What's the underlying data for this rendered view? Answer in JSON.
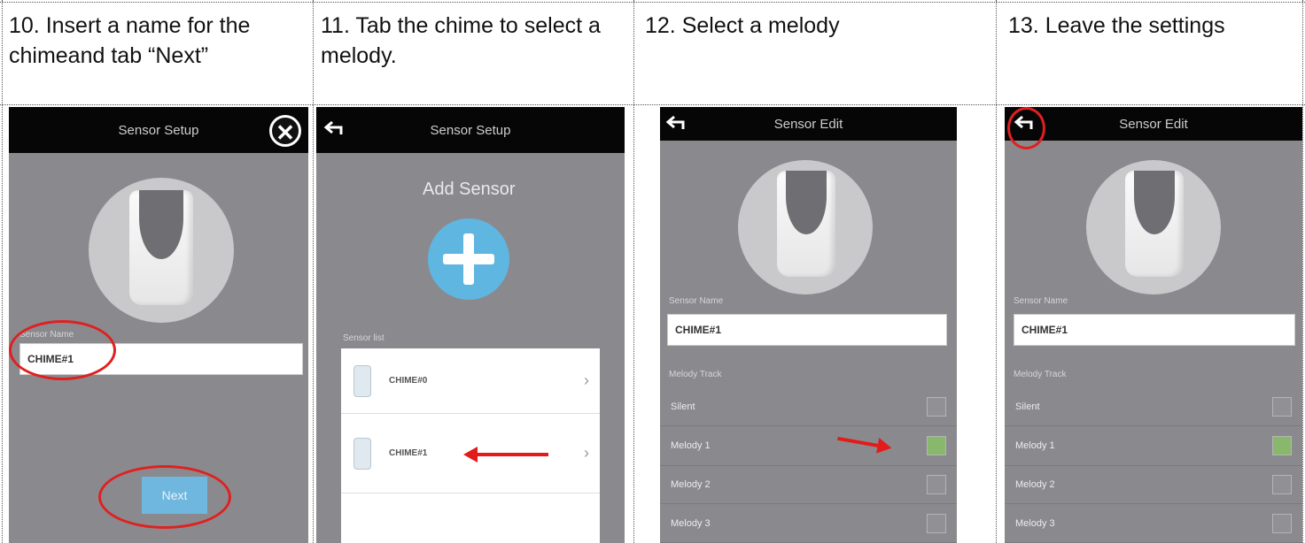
{
  "steps": [
    {
      "caption": "10. Insert a name for the chimeand tab “Next”"
    },
    {
      "caption": "11. Tab the chime to select a melody."
    },
    {
      "caption": "12. Select a melody"
    },
    {
      "caption": "13. Leave the settings"
    }
  ],
  "screen10": {
    "title": "Sensor Setup",
    "close_icon": "close-icon",
    "field_label": "Sensor Name",
    "field_value": "CHIME#1",
    "next_label": "Next"
  },
  "screen11": {
    "title": "Sensor Setup",
    "add_label": "Add Sensor",
    "list_label": "Sensor list",
    "items": [
      {
        "name": "CHIME#0"
      },
      {
        "name": "CHIME#1"
      }
    ]
  },
  "screen12": {
    "title": "Sensor Edit",
    "field_label": "Sensor Name",
    "field_value": "CHIME#1",
    "melody_label": "Melody Track",
    "melodies": [
      {
        "label": "Silent",
        "checked": false
      },
      {
        "label": "Melody 1",
        "checked": true
      },
      {
        "label": "Melody 2",
        "checked": false
      },
      {
        "label": "Melody 3",
        "checked": false
      }
    ]
  },
  "screen13": {
    "title": "Sensor Edit",
    "field_label": "Sensor Name",
    "field_value": "CHIME#1",
    "melody_label": "Melody Track",
    "melodies": [
      {
        "label": "Silent",
        "checked": false
      },
      {
        "label": "Melody 1",
        "checked": true
      },
      {
        "label": "Melody 2",
        "checked": false
      },
      {
        "label": "Melody 3",
        "checked": false
      }
    ]
  },
  "colors": {
    "annotation_red": "#e02020",
    "accent_blue": "#5fb6e0"
  }
}
